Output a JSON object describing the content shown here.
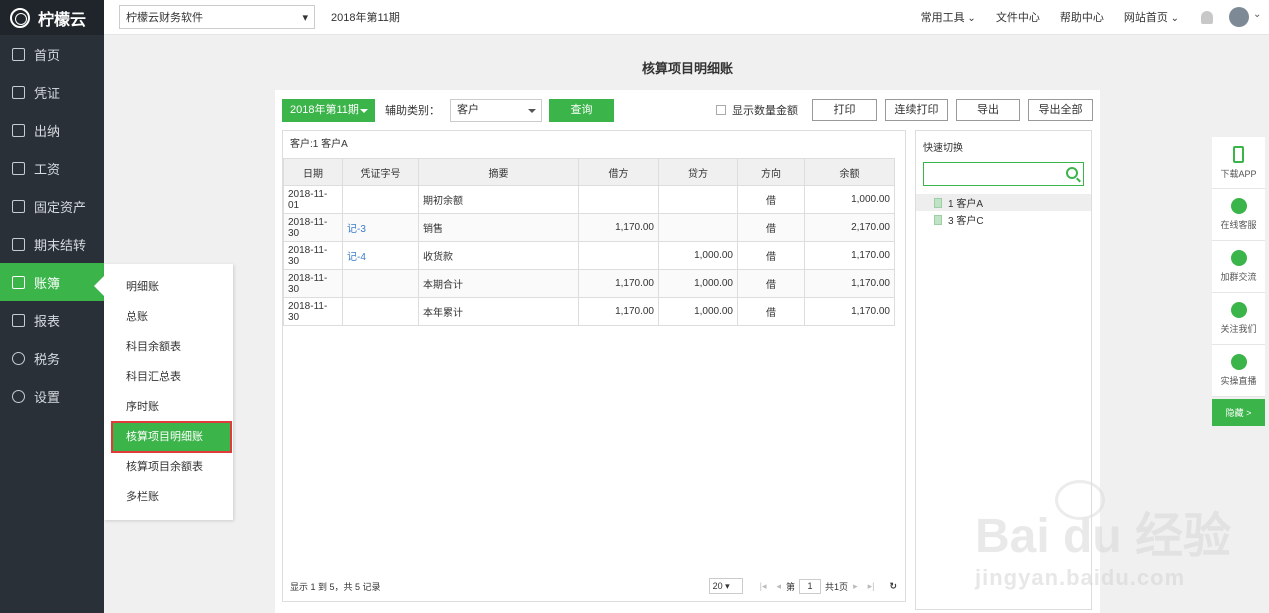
{
  "app": {
    "logo_text": "柠檬云"
  },
  "nav": [
    {
      "label": "首页",
      "icon": "home-icon"
    },
    {
      "label": "凭证",
      "icon": "voucher-icon"
    },
    {
      "label": "出纳",
      "icon": "cashier-icon"
    },
    {
      "label": "工资",
      "icon": "salary-icon"
    },
    {
      "label": "固定资产",
      "icon": "assets-icon"
    },
    {
      "label": "期末结转",
      "icon": "calendar-icon"
    },
    {
      "label": "账簿",
      "icon": "book-icon"
    },
    {
      "label": "报表",
      "icon": "chart-icon"
    },
    {
      "label": "税务",
      "icon": "tax-icon"
    },
    {
      "label": "设置",
      "icon": "gear-icon"
    }
  ],
  "submenu": [
    "明细账",
    "总账",
    "科目余额表",
    "科目汇总表",
    "序时账",
    "核算项目明细账",
    "核算项目余额表",
    "多栏账"
  ],
  "topbar": {
    "company": "柠檬云财务软件",
    "period": "2018年第11期",
    "tools": "常用工具",
    "files": "文件中心",
    "help": "帮助中心",
    "website": "网站首页"
  },
  "page": {
    "title": "核算项目明细账"
  },
  "toolbar": {
    "period": "2018年第11期",
    "aux_label": "辅助类别：",
    "aux_value": "客户",
    "query": "查询",
    "show_qty": "显示数量金额",
    "print": "打印",
    "print_cont": "连续打印",
    "export": "导出",
    "export_all": "导出全部"
  },
  "grid": {
    "customer": "客户:1 客户A",
    "headers": [
      "日期",
      "凭证字号",
      "摘要",
      "借方",
      "贷方",
      "方向",
      "余额"
    ],
    "rows": [
      [
        "2018-11-01",
        "",
        "期初余额",
        "",
        "",
        "借",
        "1,000.00"
      ],
      [
        "2018-11-30",
        "记-3",
        "销售",
        "1,170.00",
        "",
        "借",
        "2,170.00"
      ],
      [
        "2018-11-30",
        "记-4",
        "收货款",
        "",
        "1,000.00",
        "借",
        "1,170.00"
      ],
      [
        "2018-11-30",
        "",
        "本期合计",
        "1,170.00",
        "1,000.00",
        "借",
        "1,170.00"
      ],
      [
        "2018-11-30",
        "",
        "本年累计",
        "1,170.00",
        "1,000.00",
        "借",
        "1,170.00"
      ]
    ],
    "footer": "显示 1 到 5，共 5 记录",
    "page_size": "20",
    "page_prefix": "第",
    "page_num": "1",
    "page_total": "共1页"
  },
  "quick": {
    "title": "快速切换",
    "items": [
      "1 客户A",
      "3 客户C"
    ]
  },
  "rightbar": [
    {
      "label": "下载APP",
      "icon": "phone-icon"
    },
    {
      "label": "在线客服",
      "icon": "service-icon"
    },
    {
      "label": "加群交流",
      "icon": "group-icon"
    },
    {
      "label": "关注我们",
      "icon": "wechat-icon"
    },
    {
      "label": "实操直播",
      "icon": "video-icon"
    }
  ],
  "hide": "隐藏 >",
  "watermark": {
    "brand": "Bai du 经验",
    "url": "jingyan.baidu.com"
  }
}
